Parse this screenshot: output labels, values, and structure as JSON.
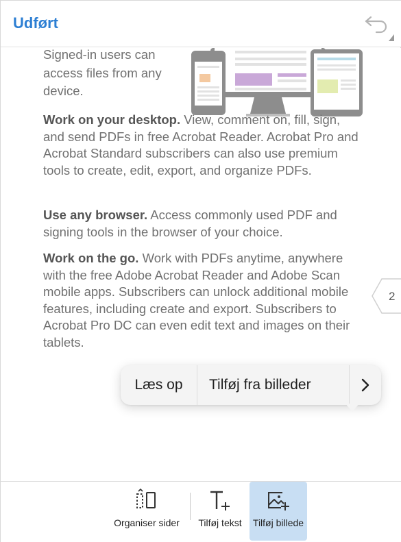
{
  "header": {
    "done_label": "Udført",
    "undo_icon": "undo-icon"
  },
  "document": {
    "signed_in": "Signed-in users can access files from any device.",
    "desktop_heading": "Work on your desktop.",
    "desktop_body": " View, comment on, fill, sign, and send PDFs in free Acrobat Reader. Acrobat Pro and Acrobat Standard subscribers can also use premium tools to create, edit, export, and organize PDFs.",
    "browser_heading": "Use any browser.",
    "browser_body": " Access commonly used PDF and signing tools in the browser of your choice.",
    "go_heading": "Work on the go.",
    "go_body": " Work with PDFs anytime, anywhere with the free Adobe Acrobat Reader and Adobe Scan mobile apps. Subscribers can unlock additional mobile features, including create and export. Subscribers to Acrobat Pro DC can even edit text and images on their tablets.",
    "page_number": "2"
  },
  "context_menu": {
    "read_aloud": "Læs op",
    "add_from_images": "Tilføj fra billeder",
    "more_icon": "chevron-right-icon"
  },
  "toolbar": {
    "organize_label": "Organiser sider",
    "add_text_label": "Tilføj tekst",
    "add_image_label": "Tilføj billede",
    "active_tool_color": "#c8def3"
  },
  "colors": {
    "accent": "#2d7fd3",
    "body_text": "#707070"
  }
}
